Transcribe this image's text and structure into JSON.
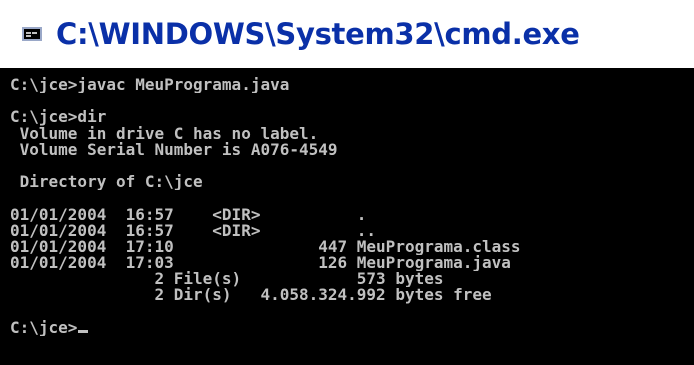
{
  "window": {
    "title": "C:\\WINDOWS\\System32\\cmd.exe",
    "icon": "console-icon"
  },
  "console": {
    "lines": [
      "C:\\jce>javac MeuPrograma.java",
      "",
      "C:\\jce>dir",
      " Volume in drive C has no label.",
      " Volume Serial Number is A076-4549",
      "",
      " Directory of C:\\jce",
      "",
      "01/01/2004  16:57    <DIR>          .",
      "01/01/2004  16:57    <DIR>          ..",
      "01/01/2004  17:10               447 MeuPrograma.class",
      "01/01/2004  17:03               126 MeuPrograma.java",
      "               2 File(s)            573 bytes",
      "               2 Dir(s)   4.058.324.992 bytes free",
      "",
      "C:\\jce>"
    ],
    "text_color": "#c0c0c0",
    "background": "#000000"
  }
}
